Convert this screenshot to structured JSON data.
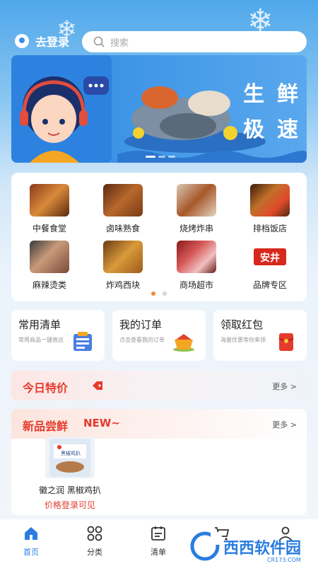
{
  "header": {
    "login_label": "去登录",
    "search_placeholder": "搜索"
  },
  "banner": {
    "title_line1": "生鲜",
    "title_line2": "极速"
  },
  "categories": [
    {
      "label": "中餐食堂"
    },
    {
      "label": "卤味熟食"
    },
    {
      "label": "烧烤炸串"
    },
    {
      "label": "排档饭店"
    },
    {
      "label": "麻辣烫类"
    },
    {
      "label": "炸鸡西块"
    },
    {
      "label": "商场超市"
    },
    {
      "label": "品牌专区"
    }
  ],
  "brand_logo_text": "安井",
  "quick_links": [
    {
      "title": "常用清单",
      "subtitle": "常用商品一键直达"
    },
    {
      "title": "我的订单",
      "subtitle": "点击查看我的订单"
    },
    {
      "title": "领取红包",
      "subtitle": "海量优惠等你来领"
    }
  ],
  "today_special": {
    "title": "今日特价",
    "more": "更多 >"
  },
  "new_products": {
    "title": "新品尝鲜",
    "badge": "NEW~",
    "more": "更多 >",
    "items": [
      {
        "name": "徽之润 黑椒鸡扒",
        "price_text": "价格登录可见",
        "package_text": "黑椒鸡扒"
      }
    ]
  },
  "bottom_nav": [
    {
      "label": "首页",
      "icon": "home-icon",
      "active": true
    },
    {
      "label": "分类",
      "icon": "grid-icon",
      "active": false
    },
    {
      "label": "清单",
      "icon": "list-icon",
      "active": false
    },
    {
      "label": "",
      "icon": "cart-icon",
      "active": false
    },
    {
      "label": "",
      "icon": "user-icon",
      "active": false
    }
  ],
  "watermark": {
    "text": "西西软件园",
    "url_text": "CR173.COM"
  },
  "colors": {
    "accent": "#2a7de1",
    "price_red": "#e53b2c",
    "banner_blue": "#2d82df"
  }
}
